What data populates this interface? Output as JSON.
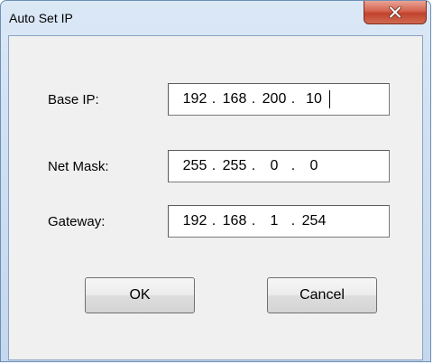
{
  "window": {
    "title": "Auto Set IP",
    "close_icon": "close-icon"
  },
  "fields": {
    "base_ip": {
      "label": "Base IP:",
      "octets": [
        "192",
        "168",
        "200",
        "10"
      ]
    },
    "net_mask": {
      "label": "Net Mask:",
      "octets": [
        "255",
        "255",
        "0",
        "0"
      ]
    },
    "gateway": {
      "label": "Gateway:",
      "octets": [
        "192",
        "168",
        "1",
        "254"
      ]
    }
  },
  "buttons": {
    "ok": "OK",
    "cancel": "Cancel"
  }
}
